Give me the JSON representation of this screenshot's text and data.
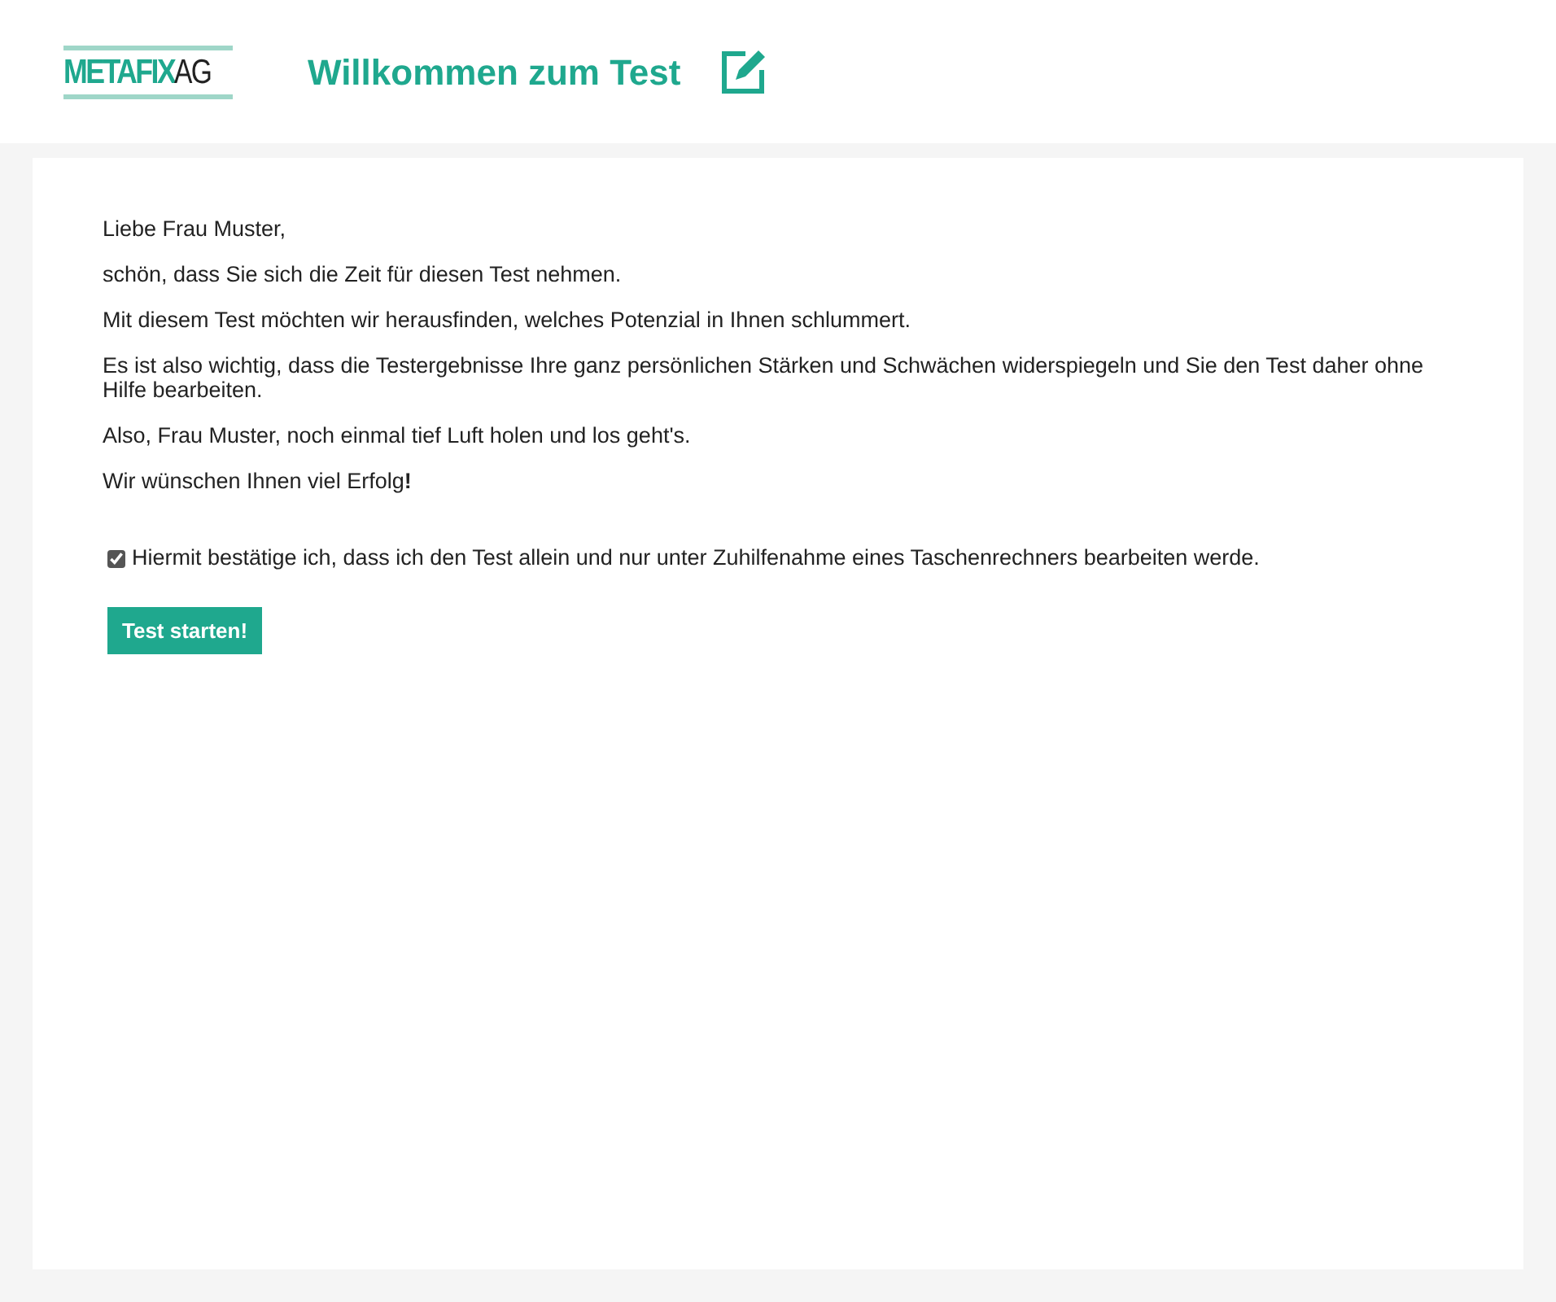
{
  "header": {
    "logo": {
      "name": "METAFIX",
      "suffix": "AG"
    },
    "title": "Willkommen zum Test"
  },
  "paragraphs": [
    "Liebe Frau Muster,",
    "schön, dass Sie sich die Zeit für diesen Test nehmen.",
    "Mit diesem Test möchten wir herausfinden, welches Potenzial in Ihnen schlummert.",
    "Es ist also wichtig, dass die Testergebnisse Ihre ganz persönlichen Stärken und Schwächen widerspiegeln und Sie den Test daher ohne Hilfe bearbeiten.",
    "Also, Frau Muster, noch einmal tief Luft holen und los geht's.",
    "Wir wünschen Ihnen viel Erfolg**!**"
  ],
  "confirmation": {
    "label": "Hiermit bestätige ich, dass ich den Test allein und nur unter Zuhilfenahme eines Taschenrechners bearbeiten werde.",
    "checked": true
  },
  "start_button": "Test starten!"
}
